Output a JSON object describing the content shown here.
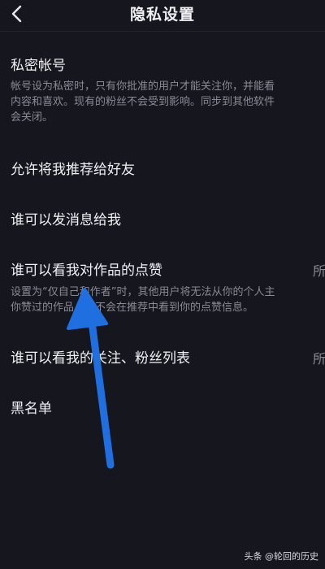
{
  "header": {
    "title": "隐私设置",
    "back_icon": "chevron-left-icon"
  },
  "settings": [
    {
      "label": "私密帐号",
      "desc_lines": [
        "帐号设为私密时，只有你批准的用户才能关注你，并能看",
        "内容和喜欢。现有的粉丝不会受到影响。同步到其他软件",
        "会关闭。"
      ]
    },
    {
      "label": "允许将我推荐给好友"
    },
    {
      "label": "谁可以发消息给我"
    },
    {
      "label": "谁可以看我对作品的点赞",
      "value": "所",
      "desc_lines": [
        "设置为“仅自己和作者”时，其他用户将无法从你的个人主",
        "你赞过的作品，且不会在推荐中看到你的点赞信息。"
      ]
    },
    {
      "label": "谁可以看我的关注、粉丝列表",
      "value": "所"
    },
    {
      "label": "黑名单"
    }
  ],
  "annotation": {
    "arrow_color": "#1f6fe0",
    "icon": "blue-arrow-annotation"
  },
  "watermark": {
    "text": "头条 @轮回的历史"
  },
  "colors": {
    "background": "#16161f",
    "text_primary": "#f0f0f4",
    "text_secondary": "#8a8a96"
  }
}
